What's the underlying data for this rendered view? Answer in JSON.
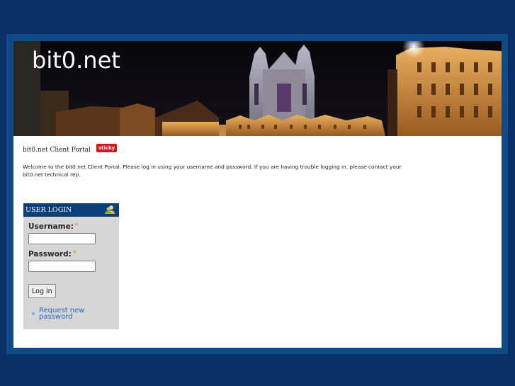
{
  "site": {
    "name": "bit0.net"
  },
  "node": {
    "title": "bit0.net Client Portal",
    "badge": "sticky",
    "intro": "Welcome to the bit0.net Client Portal. Please log in using your username and password. If you are having trouble logging in, please contact your bit0.net technical rep."
  },
  "login": {
    "title": "USER LOGIN",
    "username_label": "Username:",
    "password_label": "Password:",
    "required_mark": "*",
    "username_value": "",
    "password_value": "",
    "button_label": "Log in",
    "request_password_link": "Request new password",
    "header_icon": "users-icon"
  },
  "colors": {
    "page_background": "#0a2f66",
    "frame": "#0f4a86",
    "block_header": "#0c3e78",
    "sticky_badge": "#d01818",
    "link": "#2a6ab8"
  }
}
